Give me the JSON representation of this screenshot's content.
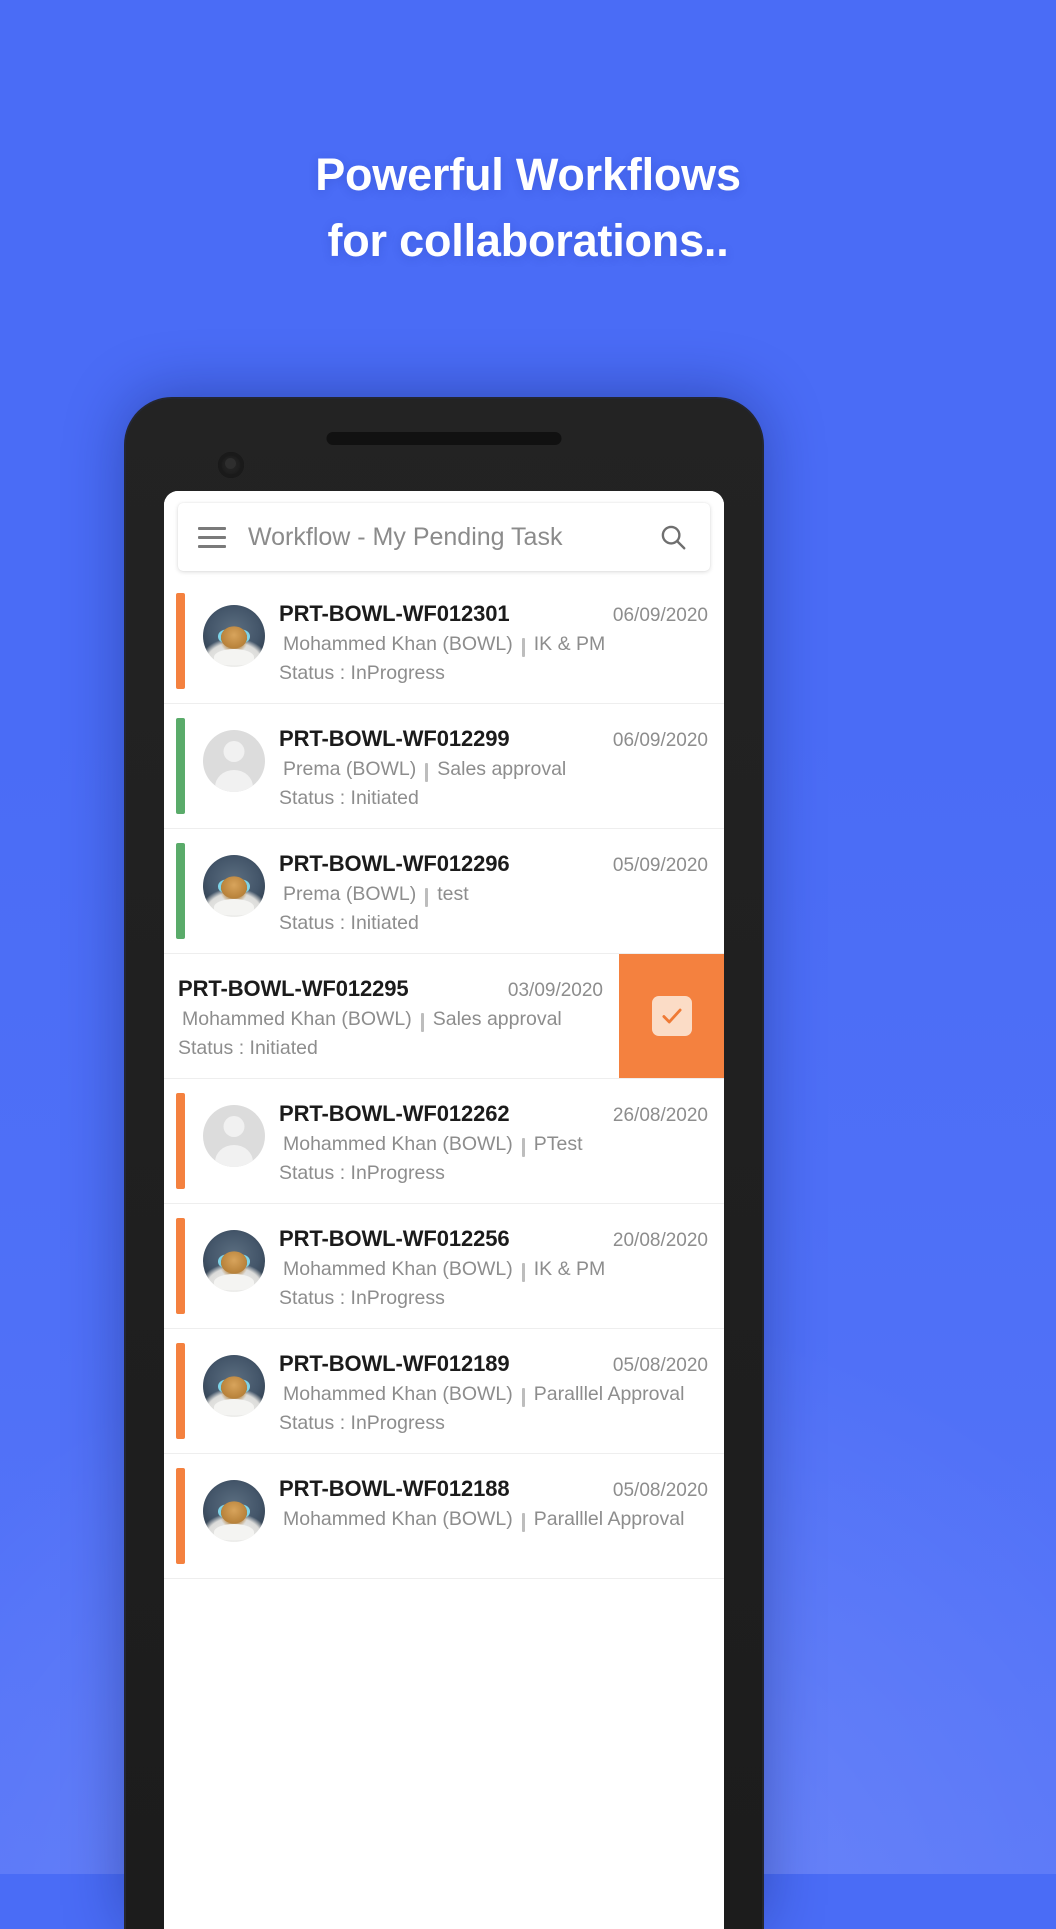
{
  "promo": {
    "headline_line1": "Powerful Workflows",
    "headline_line2": "for collaborations..",
    "background_color": "#4a6cf6",
    "text_color": "#ffffff"
  },
  "appbar": {
    "menu_icon": "hamburger-menu-icon",
    "title": "Workflow - My Pending Task",
    "search_icon": "search-icon"
  },
  "colors": {
    "accent_orange": "#f4813f",
    "accent_green": "#57b濃",
    "status_inprogress": "#f4813f",
    "status_initiated": "#5aab6a",
    "action_button": "#f4813f",
    "action_icon_bg": "#fbdcc6"
  },
  "list": {
    "separator_char": "|",
    "status_prefix": "Status : ",
    "items": [
      {
        "id": "PRT-BOWL-WF012301",
        "date": "06/09/2020",
        "owner": "Mohammed Khan (BOWL)",
        "workflow": "IK & PM",
        "status": "InProgress",
        "status_text": "Status : InProgress",
        "accent": "#f4813f",
        "avatar": "photo",
        "swiped": false
      },
      {
        "id": "PRT-BOWL-WF012299",
        "date": "06/09/2020",
        "owner": "Prema  (BOWL)",
        "workflow": "Sales approval",
        "status": "Initiated",
        "status_text": "Status : Initiated",
        "accent": "#5aab6a",
        "avatar": "person",
        "swiped": false
      },
      {
        "id": "PRT-BOWL-WF012296",
        "date": "05/09/2020",
        "owner": "Prema  (BOWL)",
        "workflow": "test",
        "status": "Initiated",
        "status_text": "Status : Initiated",
        "accent": "#5aab6a",
        "avatar": "photo",
        "swiped": false
      },
      {
        "id": "PRT-BOWL-WF012295",
        "date": "03/09/2020",
        "owner": "Mohammed Khan (BOWL)",
        "workflow": "Sales approval",
        "status": "Initiated",
        "status_text": "Status : Initiated",
        "accent": "#f4813f",
        "avatar": "none",
        "swiped": true,
        "action_label": "approve-checkbox-icon"
      },
      {
        "id": "PRT-BOWL-WF012262",
        "date": "26/08/2020",
        "owner": "Mohammed Khan (BOWL)",
        "workflow": "PTest",
        "status": "InProgress",
        "status_text": "Status : InProgress",
        "accent": "#f4813f",
        "avatar": "person",
        "swiped": false
      },
      {
        "id": "PRT-BOWL-WF012256",
        "date": "20/08/2020",
        "owner": "Mohammed Khan (BOWL)",
        "workflow": "IK & PM",
        "status": "InProgress",
        "status_text": "Status : InProgress",
        "accent": "#f4813f",
        "avatar": "photo",
        "swiped": false
      },
      {
        "id": "PRT-BOWL-WF012189",
        "date": "05/08/2020",
        "owner": "Mohammed Khan (BOWL)",
        "workflow": "Paralllel Approval",
        "status": "InProgress",
        "status_text": "Status : InProgress",
        "accent": "#f4813f",
        "avatar": "photo",
        "swiped": false
      },
      {
        "id": "PRT-BOWL-WF012188",
        "date": "05/08/2020",
        "owner": "Mohammed Khan (BOWL)",
        "workflow": "Paralllel Approval",
        "status": "",
        "status_text": "",
        "accent": "#f4813f",
        "avatar": "photo",
        "swiped": false
      }
    ]
  }
}
